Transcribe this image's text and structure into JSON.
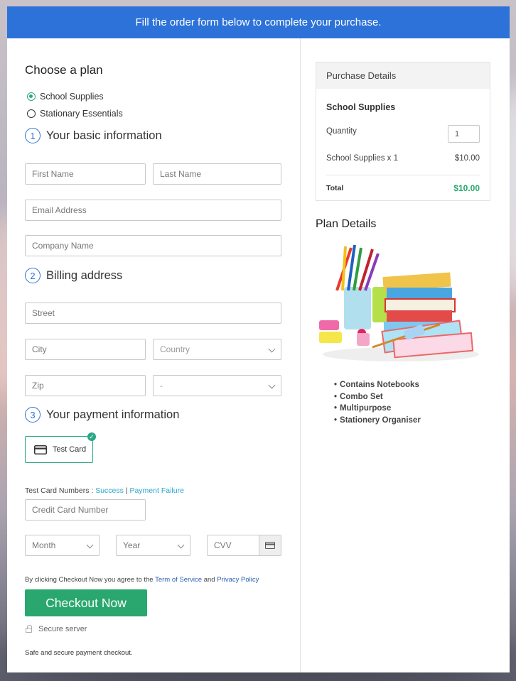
{
  "banner": {
    "text": "Fill the order form below to complete your purchase."
  },
  "plan": {
    "heading": "Choose a plan",
    "options": [
      {
        "label": "School Supplies",
        "selected": true
      },
      {
        "label": "Stationary Essentials",
        "selected": false
      }
    ]
  },
  "basic": {
    "number": "1",
    "heading": "Your basic information",
    "first_name": "First Name",
    "last_name": "Last Name",
    "email": "Email Address",
    "company": "Company Name"
  },
  "billing": {
    "number": "2",
    "heading": "Billing address",
    "street": "Street",
    "city": "City",
    "country": "Country",
    "zip": "Zip",
    "state": "-"
  },
  "payment": {
    "number": "3",
    "heading": "Your payment information",
    "method_label": "Test Card",
    "test_numbers_label": "Test Card Numbers :",
    "success_link": "Success",
    "separator": "|",
    "failure_link": "Payment Failure",
    "card_number": "Credit Card Number",
    "month": "Month",
    "year": "Year",
    "cvv": "CVV"
  },
  "terms": {
    "prefix": "By clicking Checkout Now you agree to the",
    "tos": "Term of Service",
    "and": "and",
    "privacy": "Privacy Policy"
  },
  "checkout": {
    "button": "Checkout Now",
    "secure": "Secure server",
    "note": "Safe and secure payment checkout."
  },
  "purchase": {
    "heading": "Purchase Details",
    "product": "School Supplies",
    "quantity_label": "Quantity",
    "quantity_value": "1",
    "line_item": "School Supplies x 1",
    "line_price": "$10.00",
    "total_label": "Total",
    "total_value": "$10.00",
    "total_color": "#2aa76f"
  },
  "plan_details": {
    "heading": "Plan Details",
    "features": [
      "Contains Notebooks",
      "Combo Set",
      "Multipurpose",
      "Stationery Organiser"
    ]
  },
  "colors": {
    "accent": "#2d72d9",
    "success": "#2aa76f"
  }
}
